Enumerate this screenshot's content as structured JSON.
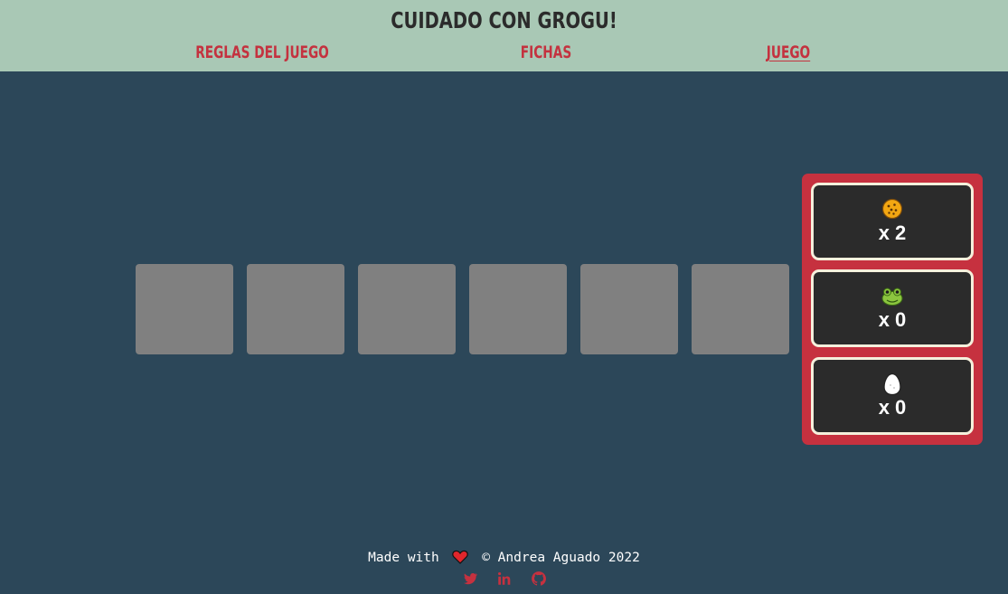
{
  "header": {
    "title": "CUIDADO CON GROGU!",
    "nav": [
      {
        "label": "REGLAS DEL JUEGO"
      },
      {
        "label": "FICHAS"
      },
      {
        "label": "JUEGO",
        "active": true
      }
    ]
  },
  "board": {
    "tiles": 6,
    "tile_color": "#808080"
  },
  "panel": {
    "counters": [
      {
        "icon": "cookie-icon",
        "label": "x 2"
      },
      {
        "icon": "frog-icon",
        "label": "x 0"
      },
      {
        "icon": "egg-icon",
        "label": "x 0"
      }
    ]
  },
  "footer": {
    "made_with": "Made with",
    "heart_icon": "heart-icon",
    "copyright": "© Andrea Aguado 2022",
    "social": [
      "twitter-icon",
      "linkedin-icon",
      "github-icon"
    ]
  },
  "colors": {
    "header_bg": "#a9c8b5",
    "page_bg": "#2c4759",
    "accent": "#c6313f",
    "counter_bg": "#2b2b2b"
  }
}
